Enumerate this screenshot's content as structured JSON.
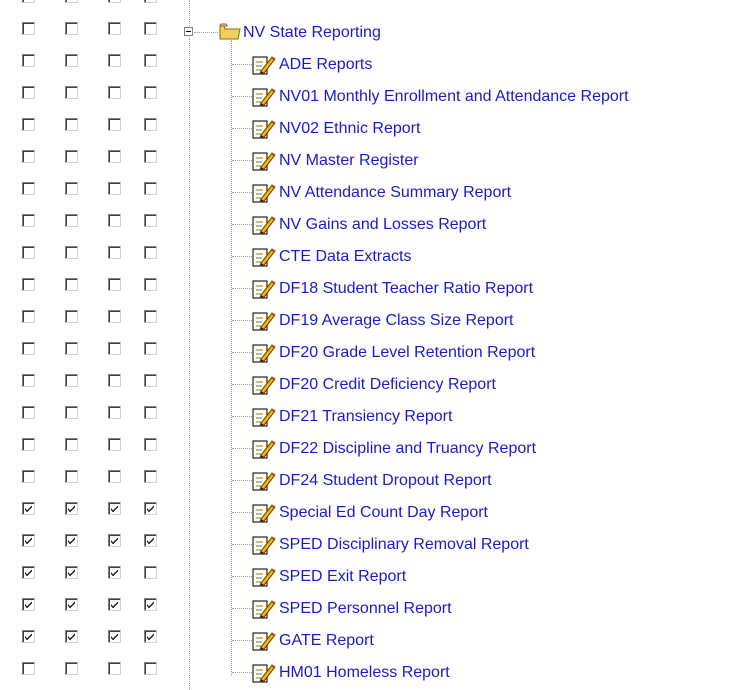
{
  "folder": {
    "label": "NV State Reporting",
    "icon": "folder-open-icon"
  },
  "colors": {
    "link": "#1a1acc",
    "folder": "#f0d060"
  },
  "reports": [
    {
      "label": "ADE Reports",
      "checks": [
        false,
        false,
        false,
        false
      ]
    },
    {
      "label": "NV01 Monthly Enrollment and Attendance Report",
      "checks": [
        false,
        false,
        false,
        false
      ]
    },
    {
      "label": "NV02 Ethnic Report",
      "checks": [
        false,
        false,
        false,
        false
      ]
    },
    {
      "label": "NV Master Register",
      "checks": [
        false,
        false,
        false,
        false
      ]
    },
    {
      "label": "NV Attendance Summary Report",
      "checks": [
        false,
        false,
        false,
        false
      ]
    },
    {
      "label": "NV Gains and Losses Report",
      "checks": [
        false,
        false,
        false,
        false
      ]
    },
    {
      "label": "CTE Data Extracts",
      "checks": [
        false,
        false,
        false,
        false
      ]
    },
    {
      "label": "DF18 Student Teacher Ratio Report",
      "checks": [
        false,
        false,
        false,
        false
      ]
    },
    {
      "label": "DF19 Average Class Size Report",
      "checks": [
        false,
        false,
        false,
        false
      ]
    },
    {
      "label": "DF20 Grade Level Retention Report",
      "checks": [
        false,
        false,
        false,
        false
      ]
    },
    {
      "label": "DF20 Credit Deficiency Report",
      "checks": [
        false,
        false,
        false,
        false
      ]
    },
    {
      "label": "DF21 Transiency Report",
      "checks": [
        false,
        false,
        false,
        false
      ]
    },
    {
      "label": "DF22 Discipline and Truancy Report",
      "checks": [
        false,
        false,
        false,
        false
      ]
    },
    {
      "label": "DF24 Student Dropout Report",
      "checks": [
        false,
        false,
        false,
        false
      ]
    },
    {
      "label": "Special Ed Count Day Report",
      "checks": [
        true,
        true,
        true,
        true
      ]
    },
    {
      "label": "SPED Disciplinary Removal Report",
      "checks": [
        true,
        true,
        true,
        true
      ]
    },
    {
      "label": "SPED Exit Report",
      "checks": [
        true,
        true,
        true,
        false
      ]
    },
    {
      "label": "SPED Personnel Report",
      "checks": [
        true,
        true,
        true,
        true
      ]
    },
    {
      "label": "GATE Report",
      "checks": [
        true,
        true,
        true,
        true
      ]
    },
    {
      "label": "HM01 Homeless Report",
      "checks": [
        false,
        false,
        false,
        false
      ]
    }
  ]
}
